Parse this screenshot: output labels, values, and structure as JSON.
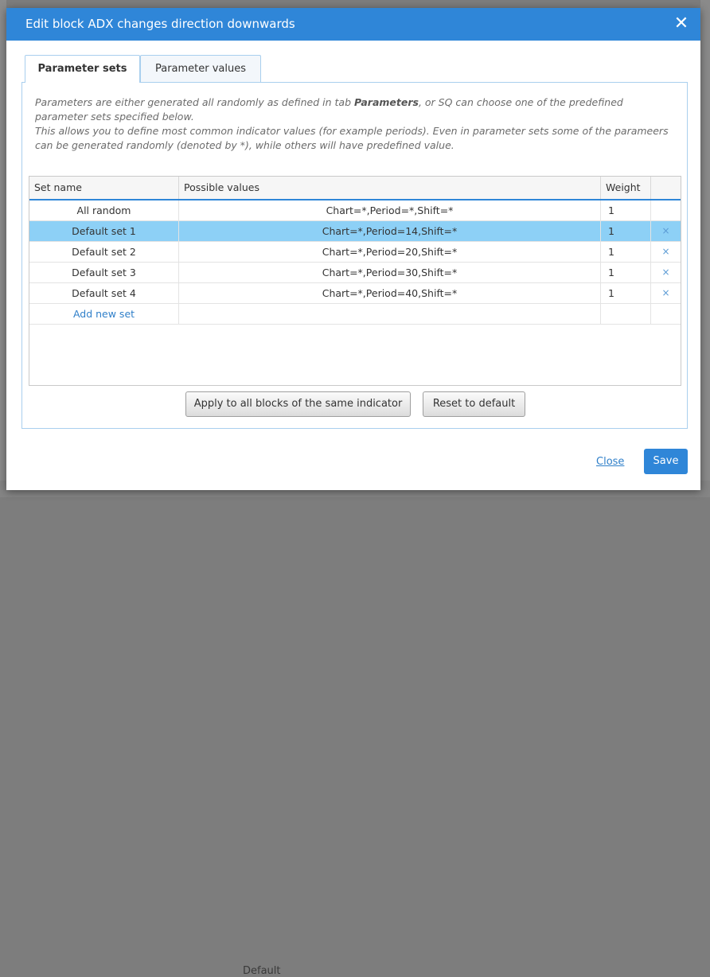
{
  "background": {
    "bottom_label": "Default"
  },
  "dialog": {
    "title": "Edit block ADX changes direction downwards",
    "close_glyph": "✕"
  },
  "tabs": [
    {
      "label": "Parameter sets",
      "active": true
    },
    {
      "label": "Parameter values",
      "active": false
    }
  ],
  "description": {
    "line1_a": "Parameters are either generated all randomly as defined in tab ",
    "line1_b": "Parameters",
    "line1_c": ", or SQ can choose one of the predefined parameter sets specified below.",
    "line2": "This allows you to define most common indicator values (for example periods). Even in parameter sets some of the parameers can be generated randomly (denoted by *), while others will have predefined value."
  },
  "table": {
    "columns": [
      "Set name",
      "Possible values",
      "Weight",
      ""
    ],
    "rows": [
      {
        "name": "All random",
        "values": "Chart=*,Period=*,Shift=*",
        "weight": "1",
        "deletable": false,
        "selected": false
      },
      {
        "name": "Default set 1",
        "values": "Chart=*,Period=14,Shift=*",
        "weight": "1",
        "deletable": true,
        "selected": true
      },
      {
        "name": "Default set 2",
        "values": "Chart=*,Period=20,Shift=*",
        "weight": "1",
        "deletable": true,
        "selected": false
      },
      {
        "name": "Default set 3",
        "values": "Chart=*,Period=30,Shift=*",
        "weight": "1",
        "deletable": true,
        "selected": false
      },
      {
        "name": "Default set 4",
        "values": "Chart=*,Period=40,Shift=*",
        "weight": "1",
        "deletable": true,
        "selected": false
      }
    ],
    "add_new_label": "Add new set",
    "delete_glyph": "×"
  },
  "buttons": {
    "apply_label": "Apply to all blocks of the same indicator",
    "reset_label": "Reset to default"
  },
  "footer": {
    "close_label": "Close",
    "save_label": "Save"
  },
  "colors": {
    "header": "#2f86d8",
    "selected_row": "#8dd0f6",
    "link": "#2f7fc9"
  }
}
